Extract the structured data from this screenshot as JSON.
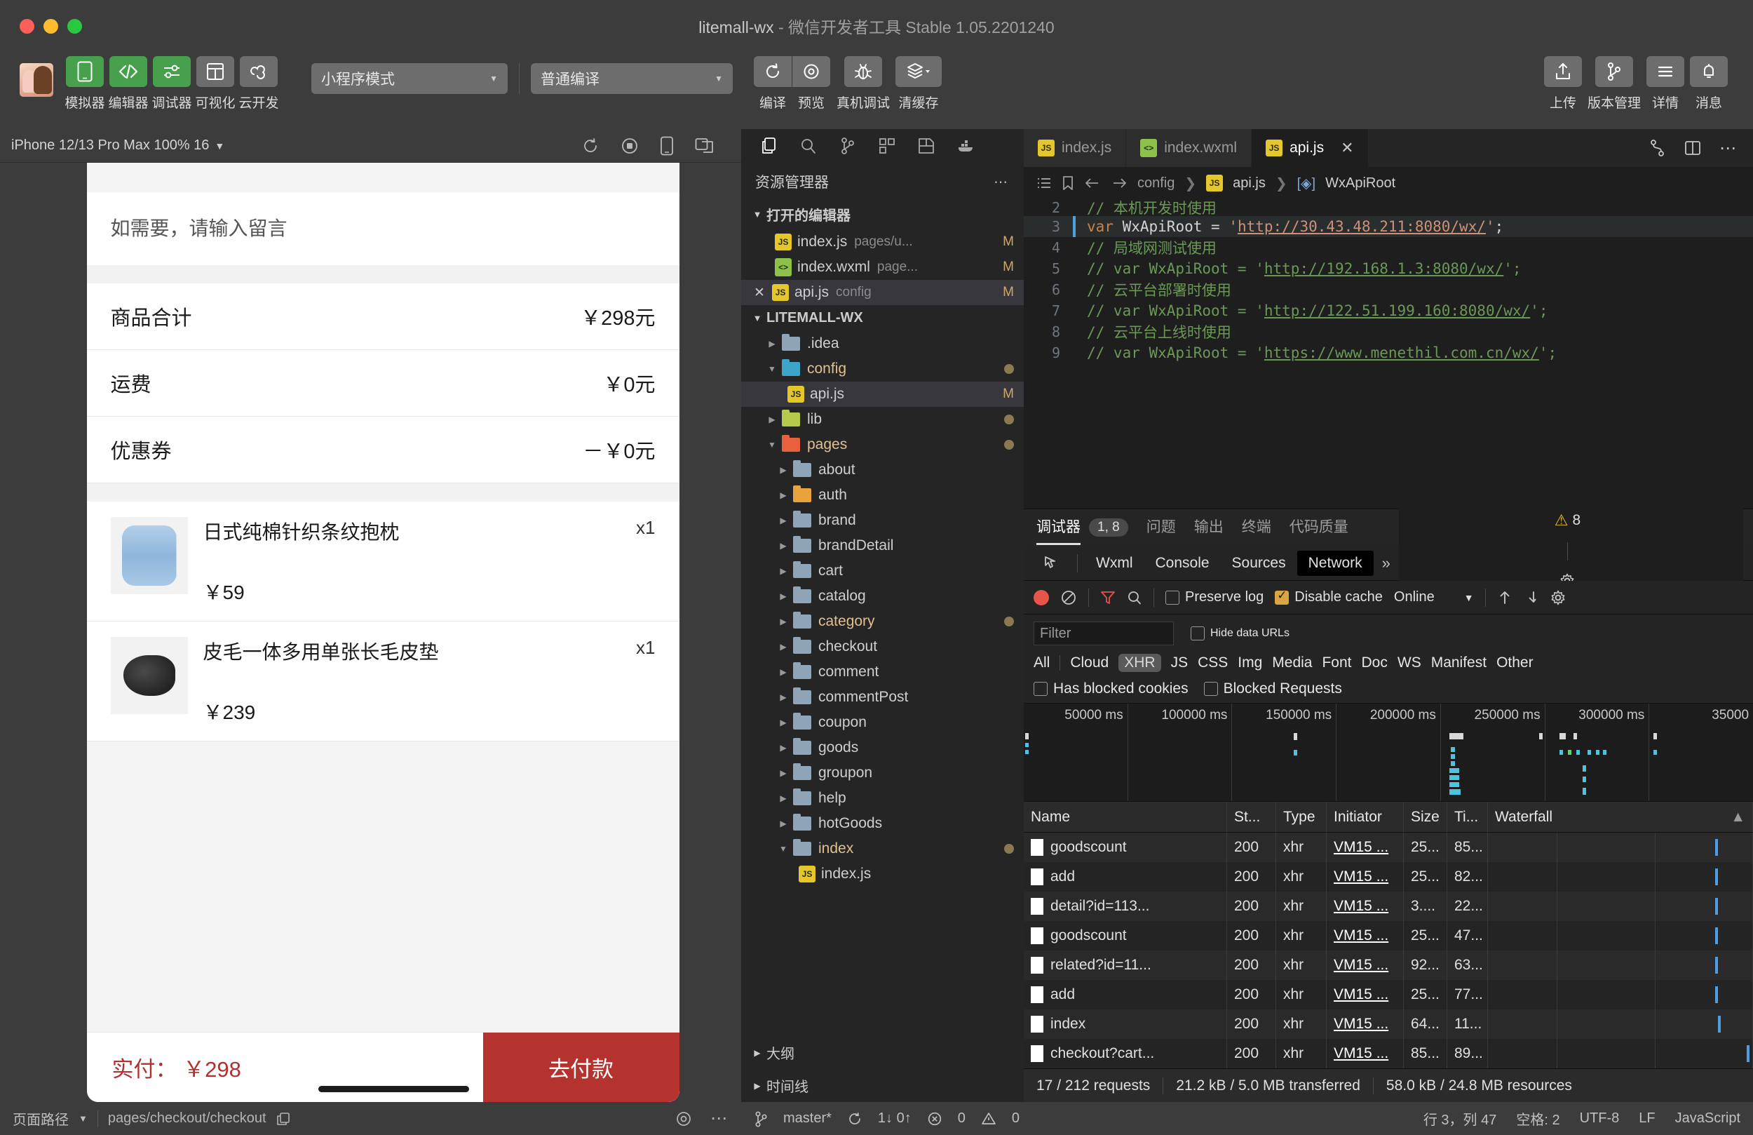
{
  "window": {
    "title": "litemall-wx",
    "subtitle": "- 微信开发者工具 Stable 1.05.2201240"
  },
  "toolbar": {
    "buttons": [
      {
        "label": "模拟器",
        "icon": "simulator-icon",
        "active": true
      },
      {
        "label": "编辑器",
        "icon": "editor-icon",
        "active": true
      },
      {
        "label": "调试器",
        "icon": "debugger-icon",
        "active": true
      },
      {
        "label": "可视化",
        "icon": "visual-icon",
        "active": false
      },
      {
        "label": "云开发",
        "icon": "cloud-icon",
        "active": false
      }
    ],
    "mode_select": "小程序模式",
    "compile_select": "普通编译",
    "actions": [
      {
        "label": "编译",
        "icon": "refresh-icon"
      },
      {
        "label": "预览",
        "icon": "preview-icon"
      },
      {
        "label": "真机调试",
        "icon": "bug-icon"
      },
      {
        "label": "清缓存",
        "icon": "layers-icon"
      }
    ],
    "right_actions": [
      {
        "label": "上传",
        "icon": "upload-icon"
      },
      {
        "label": "版本管理",
        "icon": "branch-icon"
      },
      {
        "label": "详情",
        "icon": "menu-icon"
      },
      {
        "label": "消息",
        "icon": "bell-icon"
      }
    ]
  },
  "simulator": {
    "device_label": "iPhone 12/13 Pro Max 100% 16",
    "header_icons": [
      "rotate-icon",
      "record-icon",
      "device-icon",
      "window-icon"
    ],
    "page": {
      "message_placeholder": "如需要，请输入留言",
      "summary_rows": [
        {
          "label": "商品合计",
          "value": "￥298元"
        },
        {
          "label": "运费",
          "value": "￥0元"
        },
        {
          "label": "优惠券",
          "value": "－￥0元"
        }
      ],
      "products": [
        {
          "name": "日式纯棉针织条纹抱枕",
          "price": "￥59",
          "qty": "x1",
          "thumb": "pillow"
        },
        {
          "name": "皮毛一体多用单张长毛皮垫",
          "price": "￥239",
          "qty": "x1",
          "thumb": "fur"
        }
      ],
      "pay_label": "实付：",
      "pay_amount": "￥298",
      "pay_button": "去付款"
    }
  },
  "explorer": {
    "activity_icons": [
      "files-icon",
      "search-icon",
      "source-control-icon",
      "extensions-icon",
      "save-icon",
      "docker-icon"
    ],
    "title": "资源管理器",
    "more": "⋯",
    "open_editors_label": "打开的编辑器",
    "open_editors": [
      {
        "icon": "js-icon",
        "name": "index.js",
        "path": "pages/u...",
        "badge": "M",
        "selected": false,
        "close": false
      },
      {
        "icon": "wxml-icon",
        "name": "index.wxml",
        "path": "page...",
        "badge": "M",
        "selected": false,
        "close": false
      },
      {
        "icon": "js-icon",
        "name": "api.js",
        "path": "config",
        "badge": "M",
        "selected": true,
        "close": true
      }
    ],
    "project_label": "LITEMALL-WX",
    "tree": [
      {
        "name": ".idea",
        "type": "folder",
        "icon": "folder-blue",
        "indent": 1,
        "expanded": false,
        "dot": false
      },
      {
        "name": "config",
        "type": "folder",
        "icon": "folder-cfg",
        "indent": 1,
        "expanded": true,
        "dot": true,
        "highlight": true
      },
      {
        "name": "api.js",
        "type": "file",
        "icon": "js-icon",
        "indent": 2,
        "badge": "M",
        "selected": true
      },
      {
        "name": "lib",
        "type": "folder",
        "icon": "folder-green",
        "indent": 1,
        "expanded": false,
        "dot": true
      },
      {
        "name": "pages",
        "type": "folder",
        "icon": "folder-red",
        "indent": 1,
        "expanded": true,
        "dot": true,
        "highlight": true
      },
      {
        "name": "about",
        "type": "folder",
        "icon": "folder-blue",
        "indent": 2,
        "expanded": false
      },
      {
        "name": "auth",
        "type": "folder",
        "icon": "folder-orange",
        "indent": 2,
        "expanded": false
      },
      {
        "name": "brand",
        "type": "folder",
        "icon": "folder-blue",
        "indent": 2,
        "expanded": false
      },
      {
        "name": "brandDetail",
        "type": "folder",
        "icon": "folder-blue",
        "indent": 2,
        "expanded": false
      },
      {
        "name": "cart",
        "type": "folder",
        "icon": "folder-blue",
        "indent": 2,
        "expanded": false
      },
      {
        "name": "catalog",
        "type": "folder",
        "icon": "folder-blue",
        "indent": 2,
        "expanded": false
      },
      {
        "name": "category",
        "type": "folder",
        "icon": "folder-blue",
        "indent": 2,
        "expanded": false,
        "dot": true,
        "highlight": true
      },
      {
        "name": "checkout",
        "type": "folder",
        "icon": "folder-blue",
        "indent": 2,
        "expanded": false
      },
      {
        "name": "comment",
        "type": "folder",
        "icon": "folder-blue",
        "indent": 2,
        "expanded": false
      },
      {
        "name": "commentPost",
        "type": "folder",
        "icon": "folder-blue",
        "indent": 2,
        "expanded": false
      },
      {
        "name": "coupon",
        "type": "folder",
        "icon": "folder-blue",
        "indent": 2,
        "expanded": false
      },
      {
        "name": "goods",
        "type": "folder",
        "icon": "folder-blue",
        "indent": 2,
        "expanded": false
      },
      {
        "name": "groupon",
        "type": "folder",
        "icon": "folder-blue",
        "indent": 2,
        "expanded": false
      },
      {
        "name": "help",
        "type": "folder",
        "icon": "folder-blue",
        "indent": 2,
        "expanded": false
      },
      {
        "name": "hotGoods",
        "type": "folder",
        "icon": "folder-blue",
        "indent": 2,
        "expanded": false
      },
      {
        "name": "index",
        "type": "folder",
        "icon": "folder-blue",
        "indent": 2,
        "expanded": true,
        "dot": true,
        "highlight": true
      },
      {
        "name": "index.js",
        "type": "file",
        "icon": "js-icon",
        "indent": 3
      }
    ],
    "outline_label": "大纲",
    "timeline_label": "时间线"
  },
  "editor": {
    "tabs": [
      {
        "label": "index.js",
        "icon": "js-icon",
        "active": false,
        "close": false
      },
      {
        "label": "index.wxml",
        "icon": "wxml-icon",
        "active": false,
        "close": false
      },
      {
        "label": "api.js",
        "icon": "js-icon",
        "active": true,
        "close": true
      }
    ],
    "tab_actions": [
      "split-icon",
      "layout-icon",
      "more-icon"
    ],
    "breadcrumb": [
      "config",
      "api.js",
      "WxApiRoot"
    ],
    "lines": [
      {
        "no": "2",
        "text": "// 本机开发时使用",
        "kind": "comment",
        "highlight": false
      },
      {
        "no": "3",
        "text": "var WxApiRoot = 'http://30.43.48.211:8080/wx/';",
        "kind": "code",
        "highlight": true,
        "url": "http://30.43.48.211:8080/wx/"
      },
      {
        "no": "4",
        "text": "// 局域网测试使用",
        "kind": "comment",
        "highlight": false
      },
      {
        "no": "5",
        "text": "// var WxApiRoot = 'http://192.168.1.3:8080/wx/';",
        "kind": "comment",
        "highlight": false,
        "url": "http://192.168.1.3:8080/wx/"
      },
      {
        "no": "6",
        "text": "// 云平台部署时使用",
        "kind": "comment",
        "highlight": false
      },
      {
        "no": "7",
        "text": "// var WxApiRoot = 'http://122.51.199.160:8080/wx/';",
        "kind": "comment",
        "highlight": false,
        "url": "http://122.51.199.160:8080/wx/"
      },
      {
        "no": "8",
        "text": "// 云平台上线时使用",
        "kind": "comment",
        "highlight": false
      },
      {
        "no": "9",
        "text": "// var WxApiRoot = 'https://www.menethil.com.cn/wx/';",
        "kind": "comment",
        "highlight": false,
        "url": "https://www.menethil.com.cn/wx/"
      }
    ]
  },
  "devtools": {
    "panel_tabs": [
      {
        "label": "调试器",
        "active": true,
        "badge": "1, 8"
      },
      {
        "label": "问题",
        "active": false
      },
      {
        "label": "输出",
        "active": false
      },
      {
        "label": "终端",
        "active": false
      },
      {
        "label": "代码质量",
        "active": false
      }
    ],
    "panel_actions": [
      "collapse-icon",
      "close-icon"
    ],
    "tabs": [
      {
        "label": "Wxml",
        "selected": false
      },
      {
        "label": "Console",
        "selected": false
      },
      {
        "label": "Sources",
        "selected": false
      },
      {
        "label": "Network",
        "selected": true
      }
    ],
    "overflow": "»",
    "error_count": "1",
    "warning_count": "8",
    "network_toolbar": {
      "preserve_log": {
        "label": "Preserve log",
        "checked": false
      },
      "disable_cache": {
        "label": "Disable cache",
        "checked": true
      },
      "throttle": "Online"
    },
    "filter": {
      "placeholder": "Filter",
      "value": "",
      "hide_data_urls": {
        "label": "Hide data URLs",
        "checked": false
      },
      "types": [
        "All",
        "Cloud",
        "XHR",
        "JS",
        "CSS",
        "Img",
        "Media",
        "Font",
        "Doc",
        "WS",
        "Manifest",
        "Other"
      ],
      "selected_type": "XHR",
      "has_blocked_cookies": {
        "label": "Has blocked cookies",
        "checked": false
      },
      "blocked_requests": {
        "label": "Blocked Requests",
        "checked": false
      }
    },
    "overview_ticks": [
      "50000 ms",
      "100000 ms",
      "150000 ms",
      "200000 ms",
      "250000 ms",
      "300000 ms",
      "35000"
    ],
    "table": {
      "columns": [
        "Name",
        "St...",
        "Type",
        "Initiator",
        "Size",
        "Ti...",
        "Waterfall"
      ],
      "rows": [
        {
          "name": "goodscount",
          "status": "200",
          "type": "xhr",
          "initiator": "VM15 ...",
          "size": "25...",
          "time": "85...",
          "wf": 86
        },
        {
          "name": "add",
          "status": "200",
          "type": "xhr",
          "initiator": "VM15 ...",
          "size": "25...",
          "time": "82...",
          "wf": 86
        },
        {
          "name": "detail?id=113...",
          "status": "200",
          "type": "xhr",
          "initiator": "VM15 ...",
          "size": "3....",
          "time": "22...",
          "wf": 86
        },
        {
          "name": "goodscount",
          "status": "200",
          "type": "xhr",
          "initiator": "VM15 ...",
          "size": "25...",
          "time": "47...",
          "wf": 86
        },
        {
          "name": "related?id=11...",
          "status": "200",
          "type": "xhr",
          "initiator": "VM15 ...",
          "size": "92...",
          "time": "63...",
          "wf": 86
        },
        {
          "name": "add",
          "status": "200",
          "type": "xhr",
          "initiator": "VM15 ...",
          "size": "25...",
          "time": "77...",
          "wf": 86
        },
        {
          "name": "index",
          "status": "200",
          "type": "xhr",
          "initiator": "VM15 ...",
          "size": "64...",
          "time": "11...",
          "wf": 87
        },
        {
          "name": "checkout?cart...",
          "status": "200",
          "type": "xhr",
          "initiator": "VM15 ...",
          "size": "85...",
          "time": "89...",
          "wf": 98
        }
      ]
    },
    "status": [
      "17 / 212 requests",
      "21.2 kB / 5.0 MB transferred",
      "58.0 kB / 24.8 MB resources"
    ]
  },
  "statusbar": {
    "left": {
      "page_path_label": "页面路径",
      "path": "pages/checkout/checkout",
      "copy_icon": "copy-icon",
      "eye_icon": "eye-icon",
      "more_icon": "more-icon"
    },
    "right": {
      "branch": "master*",
      "sync": "1↓ 0↑",
      "errors": "0",
      "warnings": "0",
      "cursor": "行 3，列 47",
      "spaces": "空格: 2",
      "encoding": "UTF-8",
      "eol": "LF",
      "language": "JavaScript"
    }
  },
  "colors": {
    "accent_green": "#46a04c",
    "accent_red": "#b5332f",
    "tab_active_bg": "#1e1e1e",
    "panel_bg": "#252526"
  }
}
